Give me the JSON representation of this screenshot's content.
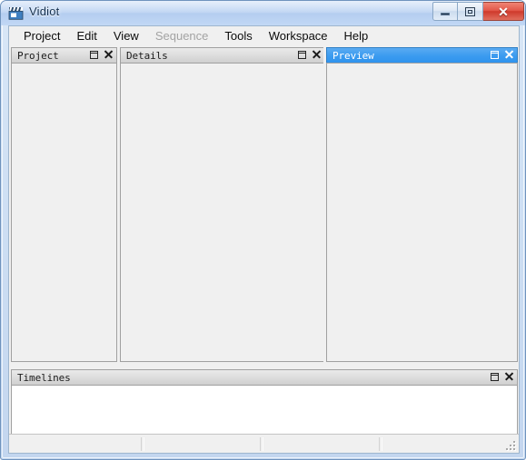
{
  "window": {
    "title": "Vidiot",
    "icon": "clapperboard-icon",
    "controls": {
      "minimize": "minimize-button",
      "maximize": "maximize-button",
      "close_label": "✕"
    }
  },
  "menubar": {
    "items": [
      {
        "label": "Project",
        "disabled": false
      },
      {
        "label": "Edit",
        "disabled": false
      },
      {
        "label": "View",
        "disabled": false
      },
      {
        "label": "Sequence",
        "disabled": true
      },
      {
        "label": "Tools",
        "disabled": false
      },
      {
        "label": "Workspace",
        "disabled": false
      },
      {
        "label": "Help",
        "disabled": false
      }
    ]
  },
  "panes": {
    "project": {
      "title": "Project",
      "active": false,
      "content": ""
    },
    "details": {
      "title": "Details",
      "active": false,
      "content": ""
    },
    "preview": {
      "title": "Preview",
      "active": true,
      "content": ""
    },
    "timelines": {
      "title": "Timelines",
      "active": false,
      "content": ""
    }
  },
  "statusbar": {
    "fields": [
      "",
      "",
      "",
      ""
    ]
  },
  "colors": {
    "frame_border": "#6f93bd",
    "titlebar": "#bcd3f2",
    "active_pane_header": "#3b9bef",
    "close_button": "#cf3a2c",
    "client_background": "#f0f0f0",
    "timeline_background": "#ffffff"
  }
}
